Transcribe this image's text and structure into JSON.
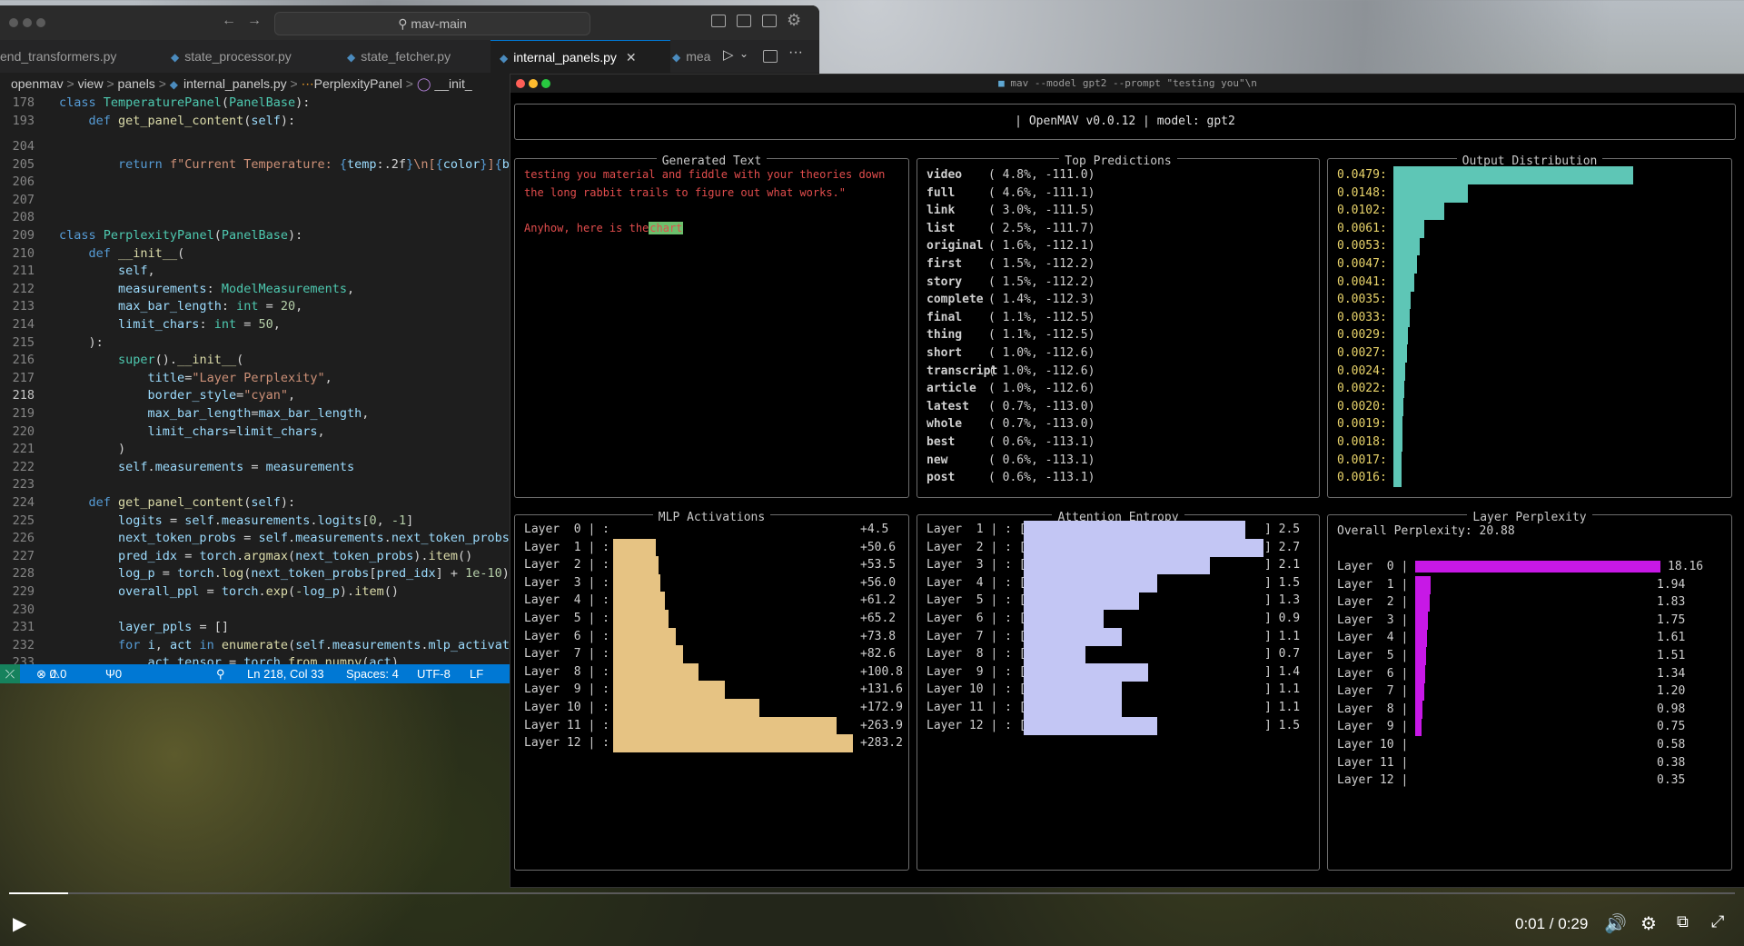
{
  "vscode": {
    "search_label": "mav-main",
    "tabs": [
      {
        "label": "end_transformers.py",
        "active": false
      },
      {
        "label": "state_processor.py",
        "active": false
      },
      {
        "label": "state_fetcher.py",
        "active": false
      },
      {
        "label": "internal_panels.py",
        "active": true
      },
      {
        "label": "mea",
        "active": false
      }
    ],
    "breadcrumb": [
      "openmav",
      "view",
      "panels",
      "internal_panels.py",
      "PerplexityPanel",
      "__init_"
    ],
    "status": {
      "errors": "0",
      "warnings": "0",
      "ports": "0",
      "position": "Ln 218, Col 33",
      "spaces": "Spaces: 4",
      "encoding": "UTF-8",
      "eol": "LF"
    }
  },
  "terminal": {
    "window_title": "mav --model gpt2 --prompt \"testing you\"\\n",
    "header": "| OpenMAV v0.0.12 | model: gpt2",
    "generated": {
      "title": "Generated Text",
      "line1": "testing you material and fiddle with your theories down",
      "line2": "the long rabbit trails to figure out what works.\"",
      "line3": "Anyhow, here is the",
      "highlight": "chart"
    },
    "predictions": {
      "title": "Top Predictions",
      "items": [
        {
          "token": "video",
          "prob": "( 4.8%, -111.0)"
        },
        {
          "token": "full",
          "prob": "( 4.6%, -111.1)"
        },
        {
          "token": "link",
          "prob": "( 3.0%, -111.5)"
        },
        {
          "token": "list",
          "prob": "( 2.5%, -111.7)"
        },
        {
          "token": "original",
          "prob": "( 1.6%, -112.1)"
        },
        {
          "token": "first",
          "prob": "( 1.5%, -112.2)"
        },
        {
          "token": "story",
          "prob": "( 1.5%, -112.2)"
        },
        {
          "token": "complete",
          "prob": "( 1.4%, -112.3)"
        },
        {
          "token": "final",
          "prob": "( 1.1%, -112.5)"
        },
        {
          "token": "thing",
          "prob": "( 1.1%, -112.5)"
        },
        {
          "token": "short",
          "prob": "( 1.0%, -112.6)"
        },
        {
          "token": "transcript",
          "prob": "( 1.0%, -112.6)"
        },
        {
          "token": "article",
          "prob": "( 1.0%, -112.6)"
        },
        {
          "token": "latest",
          "prob": "( 0.7%, -113.0)"
        },
        {
          "token": "whole",
          "prob": "( 0.7%, -113.0)"
        },
        {
          "token": "best",
          "prob": "( 0.6%, -113.1)"
        },
        {
          "token": "new",
          "prob": "( 0.6%, -113.1)"
        },
        {
          "token": "post",
          "prob": "( 0.6%, -113.1)"
        }
      ]
    },
    "output_distribution": {
      "title": "Output Distribution",
      "labels": [
        "0.0479:",
        "0.0148:",
        "0.0102:",
        "0.0061:",
        "0.0053:",
        "0.0047:",
        "0.0041:",
        "0.0035:",
        "0.0033:",
        "0.0029:",
        "0.0027:",
        "0.0024:",
        "0.0022:",
        "0.0020:",
        "0.0019:",
        "0.0018:",
        "0.0017:",
        "0.0016:"
      ],
      "values": [
        0.0479,
        0.0148,
        0.0102,
        0.0061,
        0.0053,
        0.0047,
        0.0041,
        0.0035,
        0.0033,
        0.0029,
        0.0027,
        0.0024,
        0.0022,
        0.002,
        0.0019,
        0.0018,
        0.0017,
        0.0016
      ],
      "color": "#5ec6b6"
    },
    "mlp": {
      "title": "MLP Activations",
      "labels": [
        "Layer  0 | :",
        "Layer  1 | :",
        "Layer  2 | :",
        "Layer  3 | :",
        "Layer  4 | :",
        "Layer  5 | :",
        "Layer  6 | :",
        "Layer  7 | :",
        "Layer  8 | :",
        "Layer  9 | :",
        "Layer 10 | :",
        "Layer 11 | :",
        "Layer 12 | :"
      ],
      "value_labels": [
        "+4.5",
        "+50.6",
        "+53.5",
        "+56.0",
        "+61.2",
        "+65.2",
        "+73.8",
        "+82.6",
        "+100.8",
        "+131.6",
        "+172.9",
        "+263.9",
        "+283.2"
      ],
      "values": [
        4.5,
        50.6,
        53.5,
        56.0,
        61.2,
        65.2,
        73.8,
        82.6,
        100.8,
        131.6,
        172.9,
        263.9,
        283.2
      ],
      "color": "#e6c383"
    },
    "entropy": {
      "title": "Attention Entropy",
      "labels": [
        "Layer  1 | : [",
        "Layer  2 | : [",
        "Layer  3 | : [",
        "Layer  4 | : [",
        "Layer  5 | : [",
        "Layer  6 | : [",
        "Layer  7 | : [",
        "Layer  8 | : [",
        "Layer  9 | : [",
        "Layer 10 | : [",
        "Layer 11 | : [",
        "Layer 12 | : ["
      ],
      "value_labels": [
        "] 2.5",
        "] 2.7",
        "] 2.1",
        "] 1.5",
        "] 1.3",
        "] 0.9",
        "] 1.1",
        "] 0.7",
        "] 1.4",
        "] 1.1",
        "] 1.1",
        "] 1.5"
      ],
      "values": [
        2.5,
        2.7,
        2.1,
        1.5,
        1.3,
        0.9,
        1.1,
        0.7,
        1.4,
        1.1,
        1.1,
        1.5
      ],
      "color": "#c3c6f4"
    },
    "perplexity": {
      "title": "Layer Perplexity",
      "overall": "Overall Perplexity: 20.88",
      "labels": [
        "Layer  0 |",
        "Layer  1 |",
        "Layer  2 |",
        "Layer  3 |",
        "Layer  4 |",
        "Layer  5 |",
        "Layer  6 |",
        "Layer  7 |",
        "Layer  8 |",
        "Layer  9 |",
        "Layer 10 |",
        "Layer 11 |",
        "Layer 12 |"
      ],
      "value_labels": [
        "18.16",
        "1.94",
        "1.83",
        "1.75",
        "1.61",
        "1.51",
        "1.34",
        "1.20",
        "0.98",
        "0.75",
        "0.58",
        "0.38",
        "0.35"
      ],
      "values": [
        18.16,
        1.94,
        1.83,
        1.75,
        1.61,
        1.51,
        1.34,
        1.2,
        0.98,
        0.75,
        0.58,
        0.38,
        0.35
      ],
      "color": "#c718e6"
    }
  },
  "video": {
    "time": "0:01 / 0:29",
    "progress": 0.034
  }
}
